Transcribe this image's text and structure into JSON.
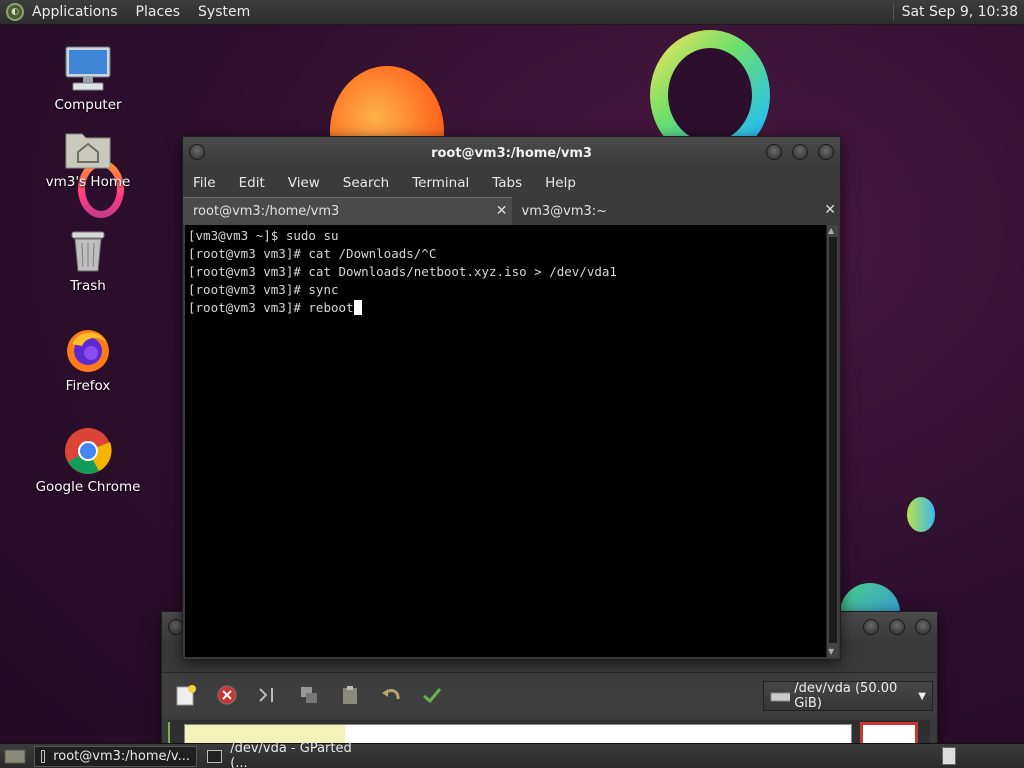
{
  "top_panel": {
    "menus": [
      "Applications",
      "Places",
      "System"
    ],
    "clock": "Sat Sep  9, 10:38"
  },
  "desktop": {
    "icons": [
      {
        "label": "Computer",
        "icon": "computer-icon"
      },
      {
        "label": "vm3's Home",
        "icon": "home-folder-icon"
      },
      {
        "label": "Trash",
        "icon": "trash-icon"
      },
      {
        "label": "Firefox",
        "icon": "firefox-icon"
      },
      {
        "label": "Google Chrome",
        "icon": "chrome-icon"
      }
    ]
  },
  "terminal": {
    "title": "root@vm3:/home/vm3",
    "menu": [
      "File",
      "Edit",
      "View",
      "Search",
      "Terminal",
      "Tabs",
      "Help"
    ],
    "tabs": [
      {
        "label": "root@vm3:/home/vm3",
        "active": true
      },
      {
        "label": "vm3@vm3:~",
        "active": false
      }
    ],
    "lines": [
      "[vm3@vm3 ~]$ sudo su",
      "[root@vm3 vm3]# cat /Downloads/^C",
      "[root@vm3 vm3]# cat Downloads/netboot.xyz.iso > /dev/vda1",
      "[root@vm3 vm3]# sync",
      "[root@vm3 vm3]# reboot"
    ]
  },
  "gparted": {
    "device": "/dev/vda  (50.00 GiB)"
  },
  "taskbar": {
    "tasks": [
      {
        "label": "root@vm3:/home/v...",
        "active": true
      },
      {
        "label": "/dev/vda - GParted (...",
        "active": false
      }
    ]
  },
  "colors": {
    "wallpaper": "#2c0f2c",
    "panel": "#333333",
    "terminal_bg": "#000000"
  }
}
